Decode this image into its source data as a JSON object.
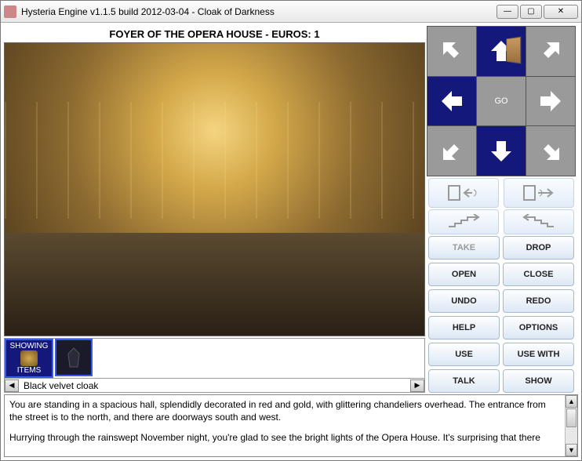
{
  "window": {
    "title": "Hysteria Engine v1.1.5 build 2012-03-04 - Cloak of Darkness"
  },
  "scene": {
    "title": "FOYER OF THE OPERA HOUSE - EUROS: 1"
  },
  "inventory": {
    "label_top": "SHOWING",
    "label_bottom": "ITEMS",
    "selected_name": "Black velvet cloak"
  },
  "compass": {
    "go_label": "GO",
    "active": {
      "n": true,
      "s": true,
      "w": true,
      "nw": false,
      "ne": false,
      "sw": false,
      "se": false,
      "e": false
    }
  },
  "actions": {
    "take": "TAKE",
    "drop": "DROP",
    "open": "OPEN",
    "close": "CLOSE",
    "undo": "UNDO",
    "redo": "REDO",
    "help": "HELP",
    "options": "OPTIONS",
    "use": "USE",
    "usewith": "USE WITH",
    "talk": "TALK",
    "show": "SHOW"
  },
  "story": {
    "p1": "You are standing in a spacious hall, splendidly decorated in red and gold, with glittering chandeliers overhead. The entrance from the street is to the north, and there are doorways south and west.",
    "p2": "Hurrying through the rainswept November night, you're glad to see the bright lights of the Opera House. It's surprising that there"
  }
}
